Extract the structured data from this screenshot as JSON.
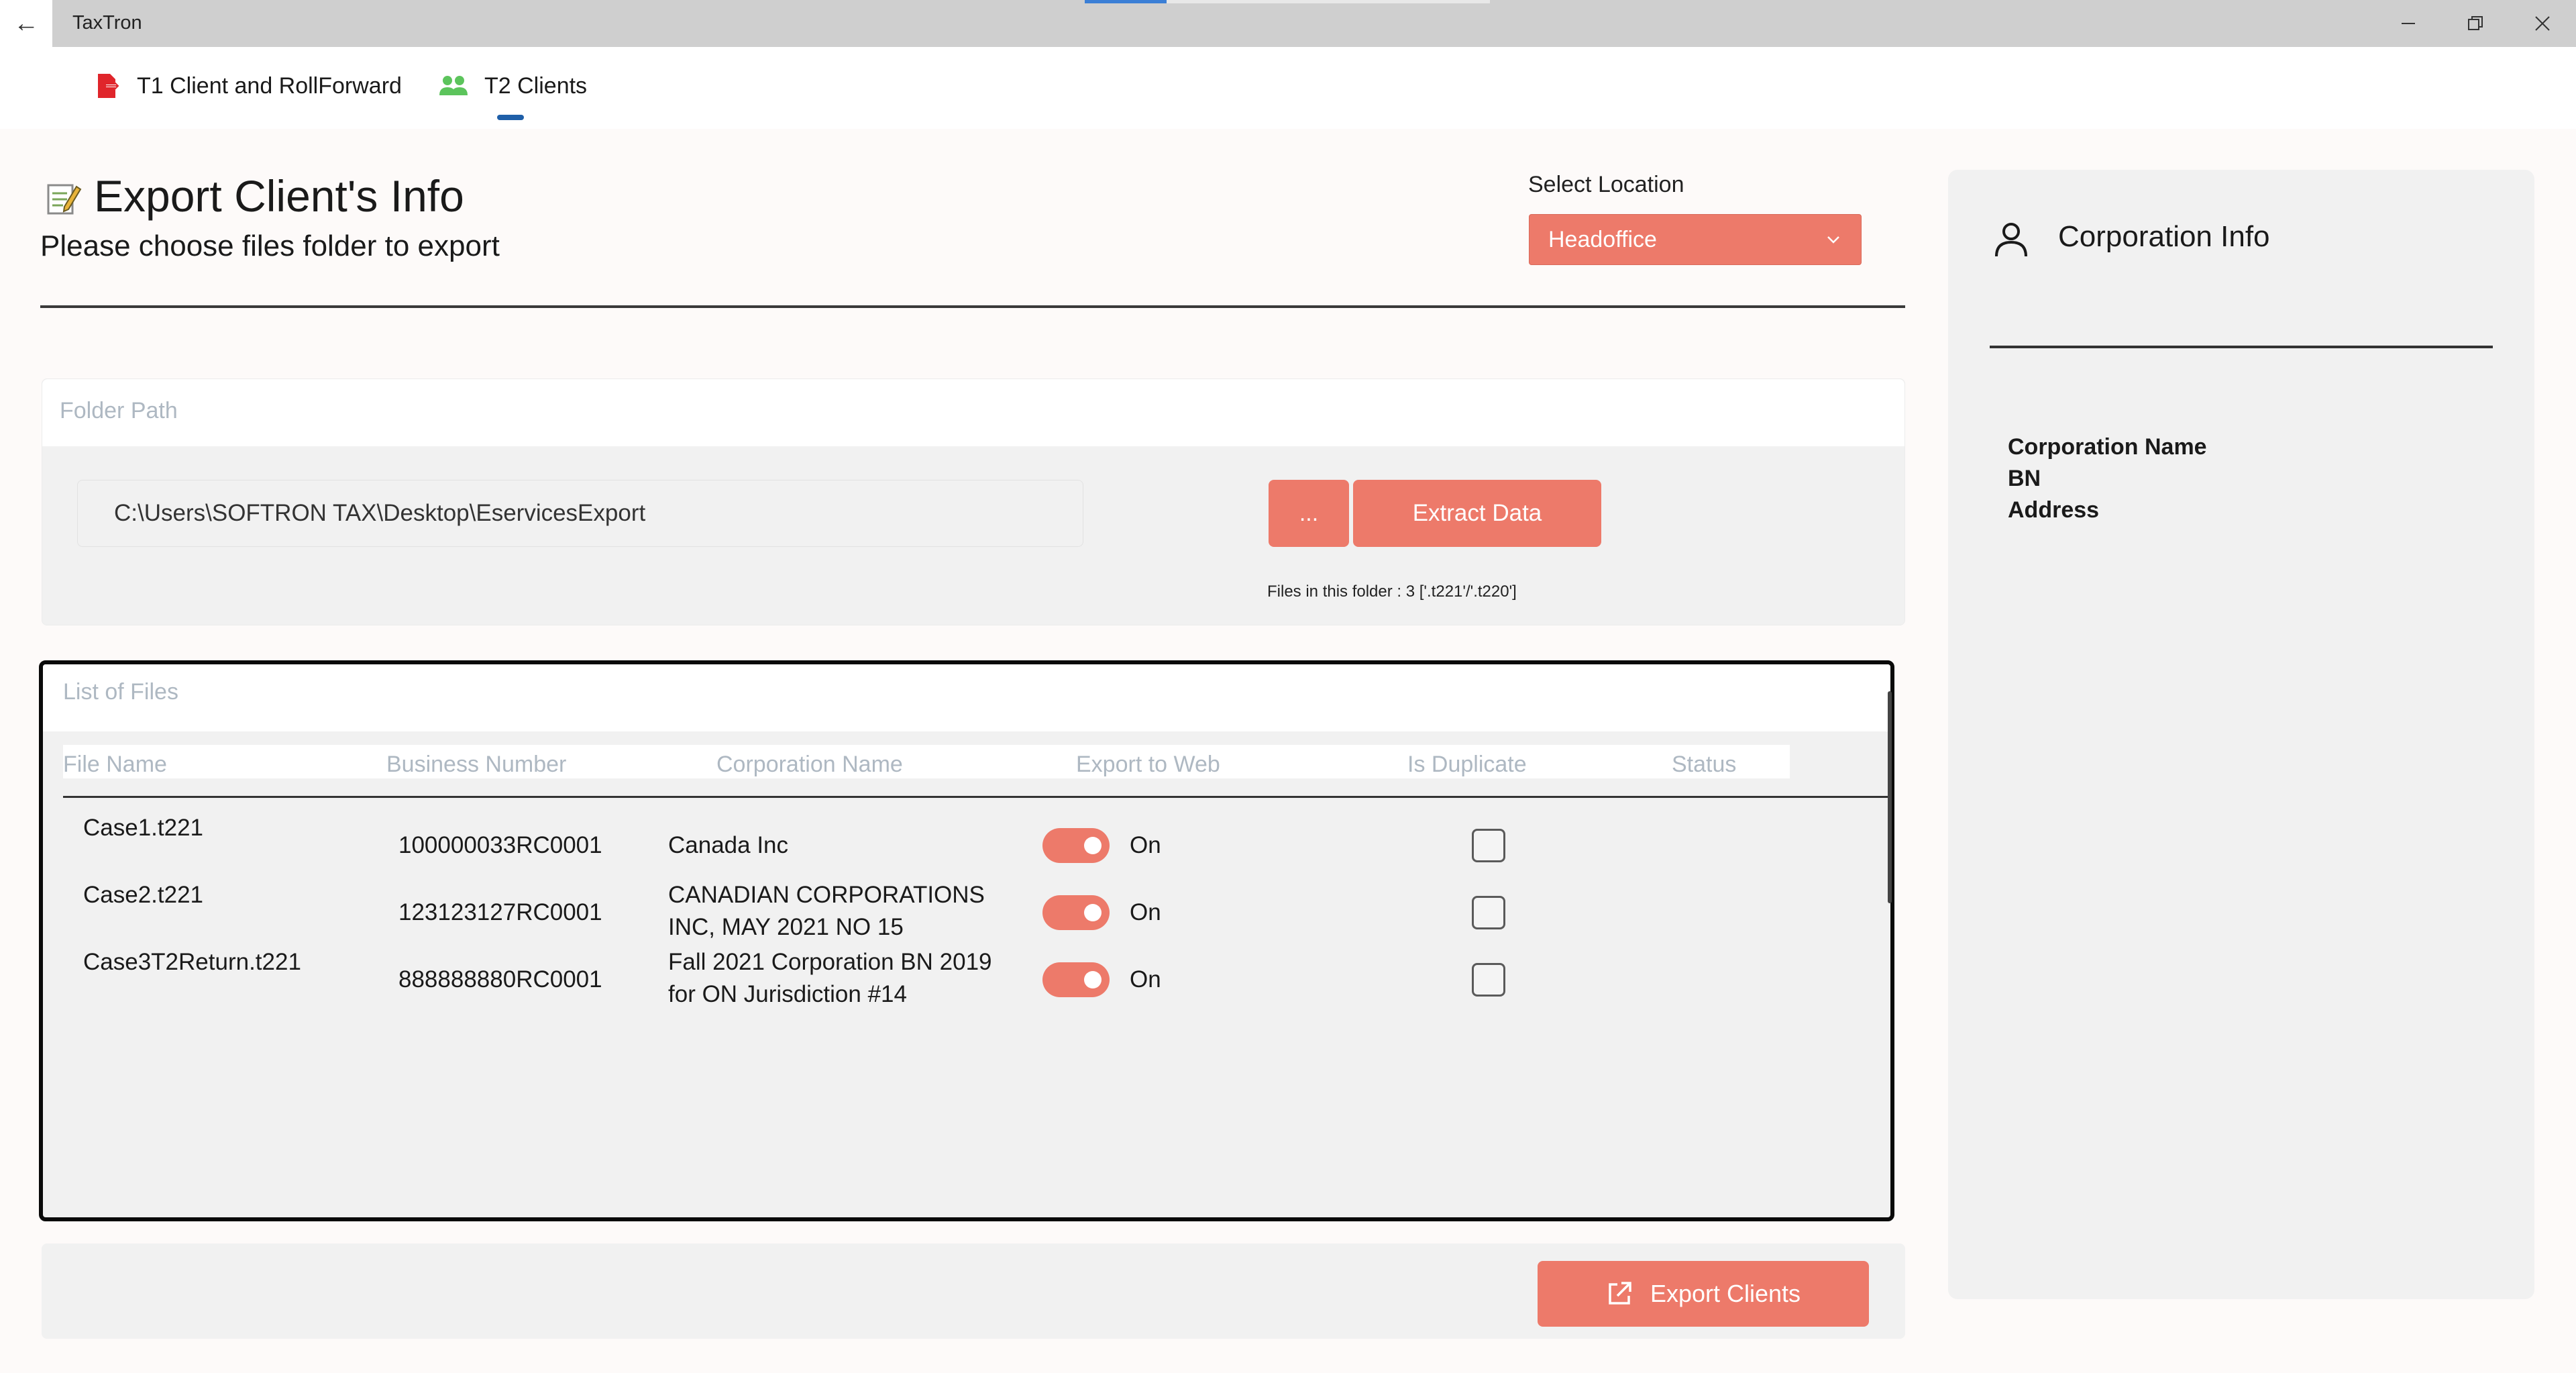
{
  "window": {
    "title": "TaxTron",
    "back_glyph": "←",
    "minimize_glyph": "—",
    "maximize_glyph": "❐",
    "close_glyph": "✕"
  },
  "nav": {
    "tabs": [
      {
        "label": "T1 Client and RollForward",
        "icon": "export-file-icon",
        "color": "#e0252b",
        "selected": false
      },
      {
        "label": "T2 Clients",
        "icon": "people-icon",
        "color": "#5cc45c",
        "selected": true
      }
    ]
  },
  "header": {
    "icon": "edit-document-icon",
    "title": "Export Client's Info",
    "subtitle": "Please choose files folder to export",
    "location_label": "Select Location",
    "location_value": "Headoffice"
  },
  "folder": {
    "legend": "Folder Path",
    "path": "C:\\Users\\SOFTRON TAX\\Desktop\\EservicesExport",
    "browse_label": "...",
    "extract_label": "Extract Data",
    "files_info": "Files in this folder : 3 ['.t221'/'.t220']"
  },
  "list": {
    "legend": "List of Files",
    "columns": [
      "File Name",
      "Business Number",
      "Corporation Name",
      "Export to Web",
      "Is Duplicate",
      "Status"
    ],
    "rows": [
      {
        "file": "Case1.t221",
        "bn": "100000033RC0001",
        "corp_line1": "Canada Inc",
        "corp_line2": "",
        "export_label": "On",
        "export_on": true,
        "duplicate": false,
        "status": ""
      },
      {
        "file": "Case2.t221",
        "bn": "123123127RC0001",
        "corp_line1": "CANADIAN CORPORATIONS",
        "corp_line2": "INC, MAY 2021 NO 15",
        "export_label": "On",
        "export_on": true,
        "duplicate": false,
        "status": ""
      },
      {
        "file": "Case3T2Return.t221",
        "bn": "888888880RC0001",
        "corp_line1": "Fall 2021 Corporation BN 2019",
        "corp_line2": "for ON Jurisdiction #14",
        "export_label": "On",
        "export_on": true,
        "duplicate": false,
        "status": ""
      }
    ]
  },
  "footer": {
    "export_label": "Export Clients",
    "export_icon": "external-link-icon"
  },
  "side": {
    "title": "Corporation Info",
    "icon": "person-icon",
    "fields": [
      "Corporation Name",
      "BN",
      "Address"
    ]
  },
  "colors": {
    "accent": "#ed7a6a",
    "tab_indicator": "#1f5fa8"
  }
}
